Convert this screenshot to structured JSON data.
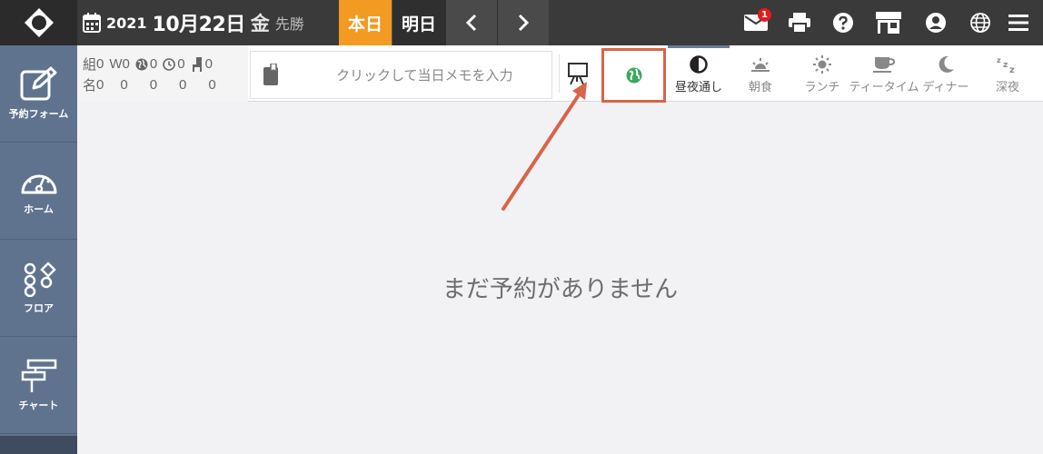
{
  "header": {
    "year": "2021",
    "month_day": "10月22日",
    "weekday": "金",
    "rokuyo": "先勝",
    "today_label": "本日",
    "tomorrow_label": "明日",
    "mail_badge": "1"
  },
  "sidebar": {
    "items": [
      {
        "label": "予約フォーム",
        "icon": "edit-icon"
      },
      {
        "label": "ホーム",
        "icon": "gauge-icon"
      },
      {
        "label": "フロア",
        "icon": "shapes-icon"
      },
      {
        "label": "チャート",
        "icon": "chart-icon"
      }
    ]
  },
  "counts": {
    "row1": {
      "label": "組",
      "w_label": "W",
      "values": [
        "0",
        "0",
        "0",
        "0",
        "0"
      ]
    },
    "row2": {
      "label": "名",
      "values": [
        "0",
        "0",
        "0",
        "0",
        "0"
      ]
    }
  },
  "memo": {
    "placeholder": "クリックして当日メモを入力"
  },
  "tabs": [
    {
      "label": "昼夜通し",
      "icon": "half-circle-icon",
      "active": true
    },
    {
      "label": "朝食",
      "icon": "sunrise-icon",
      "active": false
    },
    {
      "label": "ランチ",
      "icon": "sun-icon",
      "active": false
    },
    {
      "label": "ティータイム",
      "icon": "cup-icon",
      "active": false
    },
    {
      "label": "ディナー",
      "icon": "moon-icon",
      "active": false
    },
    {
      "label": "深夜",
      "icon": "zzz-icon",
      "active": false
    }
  ],
  "empty_message": "まだ予約がありません",
  "colors": {
    "today": "#f39a23",
    "sidebar": "#5f738e",
    "highlight": "#d8644a",
    "globe": "#3aaa5a"
  }
}
